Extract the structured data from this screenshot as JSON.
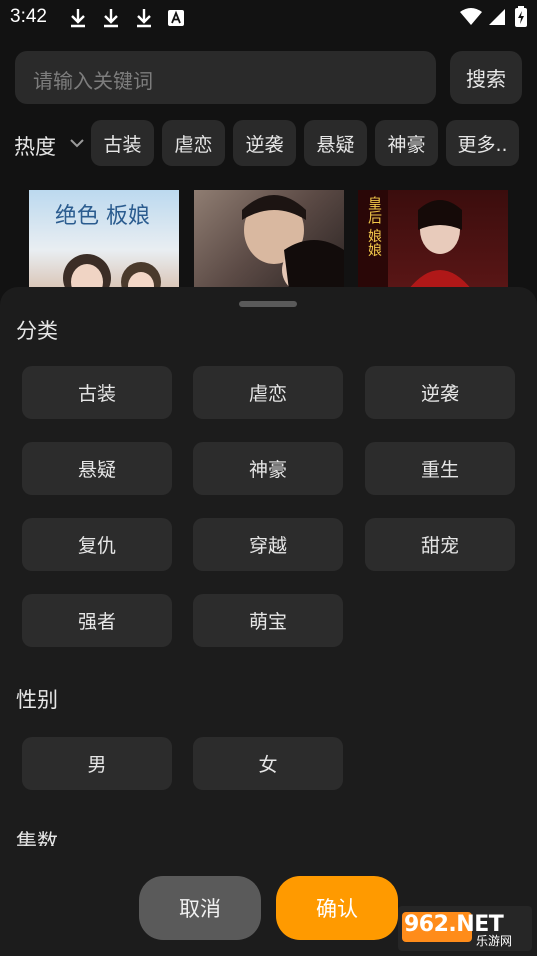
{
  "status_bar": {
    "time": "3:42"
  },
  "search": {
    "placeholder": "请输入关键词",
    "button_label": "搜索"
  },
  "hot": {
    "label": "热度",
    "tags": [
      "古装",
      "虐恋",
      "逆袭",
      "悬疑",
      "神豪",
      "更多.."
    ]
  },
  "posters": [
    {
      "text": "绝色 板娘"
    },
    {
      "text": ""
    },
    {
      "text": "皇后 娘娘"
    }
  ],
  "sheet": {
    "category_title": "分类",
    "categories": [
      "古装",
      "虐恋",
      "逆袭",
      "悬疑",
      "神豪",
      "重生",
      "复仇",
      "穿越",
      "甜宠",
      "强者",
      "萌宝"
    ],
    "gender_title": "性别",
    "genders": [
      "男",
      "女"
    ],
    "episodes_title": "集数",
    "cancel_label": "取消",
    "confirm_label": "确认"
  },
  "watermark": {
    "text": "962.NET",
    "subtext": "乐游网"
  },
  "colors": {
    "accent": "#ff9a00",
    "background": "#121212",
    "sheet": "#1c1c1c"
  }
}
